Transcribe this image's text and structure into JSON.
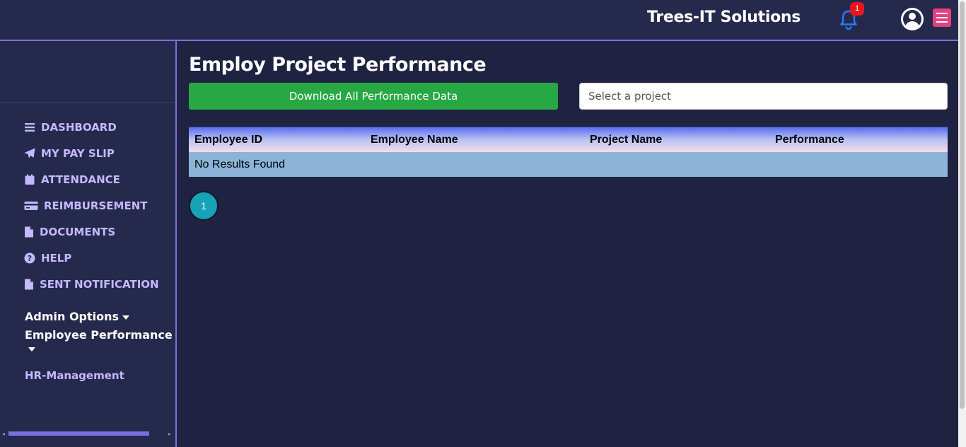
{
  "header": {
    "brand": "Trees-IT Solutions",
    "notification_count": "1",
    "icons": [
      "bell-icon",
      "user-circle-icon",
      "hamburger-menu-icon"
    ],
    "menu_color": "#e0437e",
    "accent": "#7d6fe0"
  },
  "sidebar": {
    "items": [
      {
        "label": "DASHBOARD",
        "icon": "bars-icon"
      },
      {
        "label": "MY PAY SLIP",
        "icon": "paper-plane-icon"
      },
      {
        "label": "ATTENDANCE",
        "icon": "calendar-icon"
      },
      {
        "label": "REIMBURSEMENT",
        "icon": "credit-card-icon"
      },
      {
        "label": "DOCUMENTS",
        "icon": "file-icon"
      },
      {
        "label": "HELP",
        "icon": "question-circle-icon"
      },
      {
        "label": "SENT NOTIFICATION",
        "icon": "file-icon"
      }
    ],
    "admin_options": "Admin Options",
    "employee_performance": "Employee Performance",
    "hr_management": "HR-Management"
  },
  "main": {
    "title": "Employ Project Performance",
    "download_button": "Download All Performance Data",
    "project_select_placeholder": "Select a project",
    "table": {
      "columns": [
        "Employee ID",
        "Employee Name",
        "Project Name",
        "Performance"
      ],
      "empty_text": "No Results Found"
    },
    "pagination": {
      "current_page": "1"
    },
    "download_color": "#28a745",
    "page_button_color": "#17a2b8"
  }
}
